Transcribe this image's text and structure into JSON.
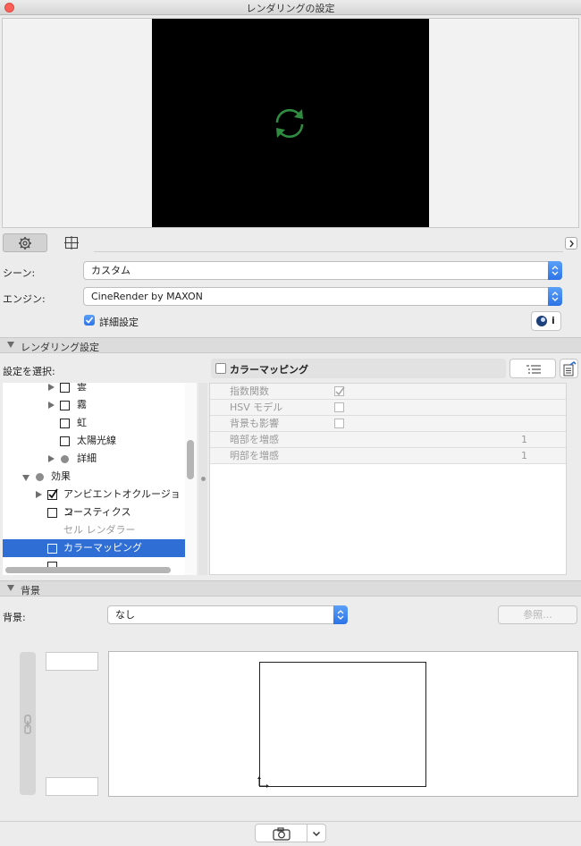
{
  "window": {
    "title": "レンダリングの設定"
  },
  "scene": {
    "label": "シーン:",
    "value": "カスタム"
  },
  "engine": {
    "label": "エンジン:",
    "value": "CineRender by MAXON"
  },
  "details": {
    "label": "詳細設定",
    "checked": true
  },
  "info_button": {
    "label": "i"
  },
  "rendering_section": {
    "title": "レンダリング設定"
  },
  "select_settings": {
    "label": "設定を選択:"
  },
  "selected_setting": {
    "title": "カラーマッピング"
  },
  "tree": [
    {
      "label": "雲"
    },
    {
      "label": "霧"
    },
    {
      "label": "虹"
    },
    {
      "label": "太陽光線"
    },
    {
      "label": "詳細"
    },
    {
      "label": "効果"
    },
    {
      "label": "アンビエントオクルージョン"
    },
    {
      "label": "コースティクス"
    },
    {
      "label": "セル レンダラー"
    },
    {
      "label": "カラーマッピング"
    }
  ],
  "properties": [
    {
      "name": "指数関数",
      "value": ""
    },
    {
      "name": "HSV モデル",
      "value": ""
    },
    {
      "name": "背景も影響",
      "value": ""
    },
    {
      "name": "暗部を増感",
      "value": "1"
    },
    {
      "name": "明部を増感",
      "value": "1"
    }
  ],
  "background_section": {
    "title": "背景"
  },
  "background": {
    "label": "背景:",
    "value": "なし",
    "browse_label": "参照..."
  },
  "colors": {
    "accent": "#2f6ed5",
    "refresh_icon": "#2e8b3f"
  }
}
